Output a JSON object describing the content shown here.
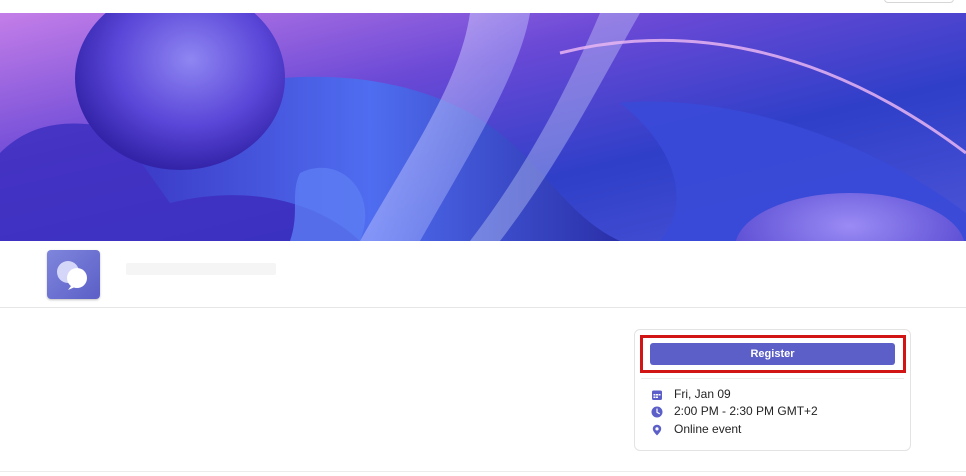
{
  "colors": {
    "accent": "#5b5fc7",
    "highlight": "#d11414",
    "text": "#242424"
  },
  "event": {
    "register_label": "Register",
    "date": "Fri, Jan 09",
    "time": "2:00 PM - 2:30 PM GMT+2",
    "location": "Online event"
  },
  "icons": {
    "logo": "chat-bubbles-icon",
    "date": "calendar-icon",
    "time": "clock-icon",
    "location": "location-pin-icon"
  }
}
